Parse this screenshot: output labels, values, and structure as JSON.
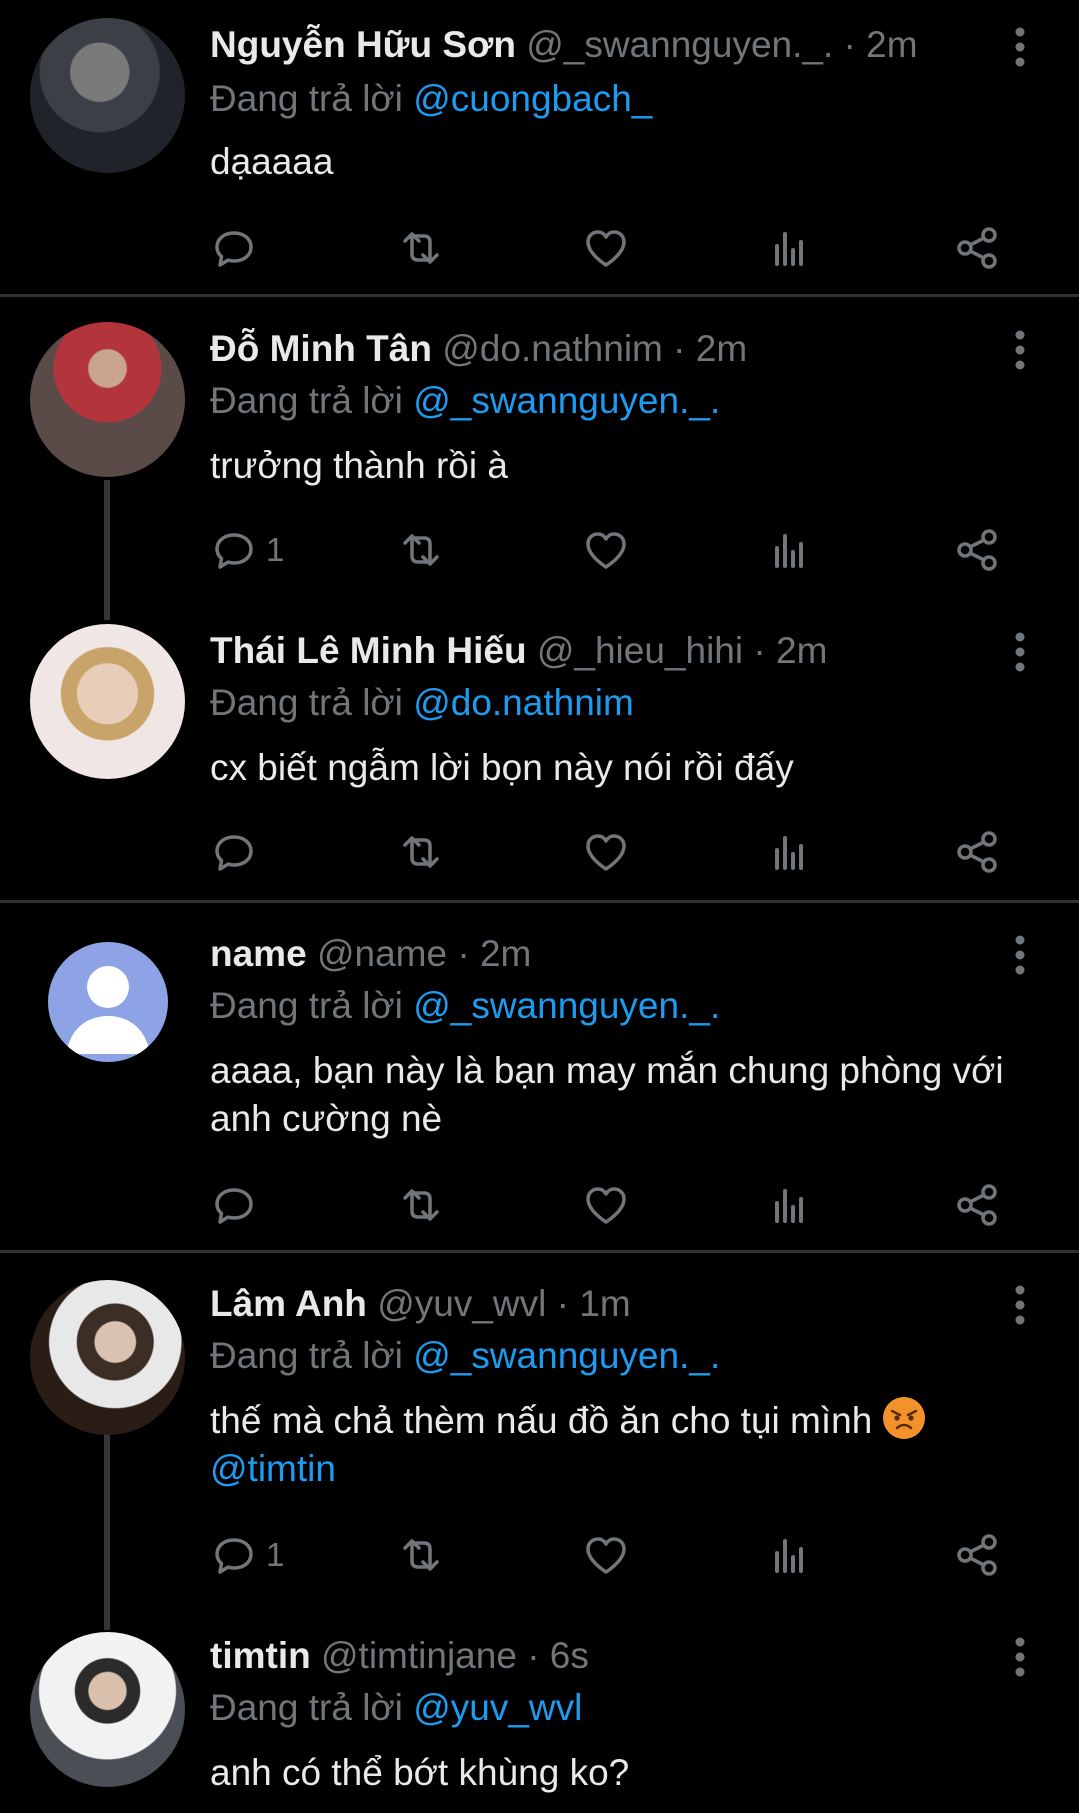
{
  "reply_prefix": "Đang trả lời",
  "tweets": [
    {
      "name": "Nguyễn Hữu Sơn",
      "handle": "@_swannguyen._.",
      "time": "· 2m",
      "reply_to": "@cuongbach_",
      "text": "dạaaaa",
      "reply_count": ""
    },
    {
      "name": "Đỗ Minh Tân",
      "handle": "@do.nathnim",
      "time": "· 2m",
      "reply_to": "@_swannguyen._.",
      "text": "trưởng thành rồi à",
      "reply_count": "1"
    },
    {
      "name": "Thái Lê Minh Hiếu",
      "handle": "@_hieu_hihi",
      "time": "· 2m",
      "reply_to": "@do.nathnim",
      "text": "cx biết ngẫm lời bọn này nói rồi đấy",
      "reply_count": ""
    },
    {
      "name": "name",
      "handle": "@name",
      "time": "· 2m",
      "reply_to": "@_swannguyen._.",
      "text": "aaaa, bạn này là bạn may mắn chung phòng với anh cường nè",
      "reply_count": ""
    },
    {
      "name": "Lâm Anh",
      "handle": "@yuv_wvl",
      "time": "· 1m",
      "reply_to": "@_swannguyen._.",
      "text": "thế mà chả thèm nấu đồ ăn cho tụi mình",
      "text_mention": "@timtin",
      "reply_count": "1"
    },
    {
      "name": "timtin",
      "handle": "@timtinjane",
      "time": "· 6s",
      "reply_to": "@yuv_wvl",
      "text": "anh có thể bớt khùng ko?",
      "reply_count": ""
    }
  ],
  "colors": {
    "background": "#000000",
    "text": "#e7e9ea",
    "muted": "#71767b",
    "accent": "#1d9bf0",
    "divider": "#2f3336"
  },
  "icons": [
    "reply-icon",
    "retweet-icon",
    "like-icon",
    "views-icon",
    "share-icon",
    "more-icon",
    "angry-emoji"
  ]
}
